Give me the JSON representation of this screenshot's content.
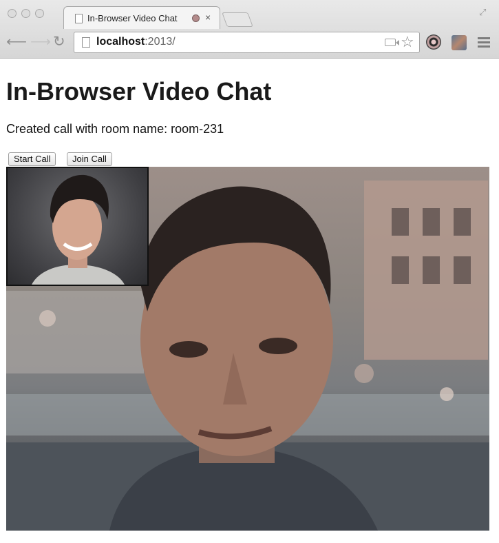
{
  "browser": {
    "tab": {
      "title": "In-Browser Video Chat",
      "close_label": "×"
    },
    "address": {
      "host": "localhost",
      "rest": ":2013/"
    }
  },
  "page": {
    "heading": "In-Browser Video Chat",
    "status": "Created call with room name: room-231",
    "buttons": {
      "start": "Start Call",
      "join": "Join Call"
    }
  },
  "colors": {
    "chrome_bg": "#dcdcdc",
    "recording_indicator": "#b38b8b"
  },
  "icons": [
    "back-arrow-icon",
    "forward-arrow-icon",
    "reload-icon",
    "page-icon",
    "camera-icon",
    "star-icon",
    "extension-icon",
    "menu-icon",
    "document-icon",
    "recording-icon",
    "close-icon",
    "fullscreen-icon"
  ]
}
